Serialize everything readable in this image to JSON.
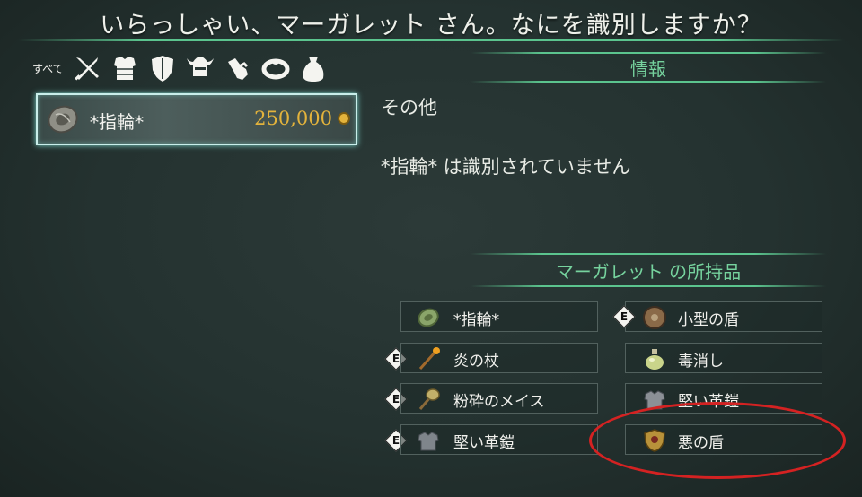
{
  "title": "いらっしゃい、マーガレット さん。なにを識別しますか？",
  "categories": {
    "all_label": "すべて",
    "icons": [
      "weapon-icon",
      "armor-icon",
      "shield-icon",
      "helmet-icon",
      "gauntlet-icon",
      "ring-icon",
      "pouch-icon"
    ]
  },
  "selected_item": {
    "name": "*指輪*",
    "price": "250,000",
    "icon": "ring-icon"
  },
  "info": {
    "header": "情報",
    "category": "その他",
    "description": "*指輪* は識別されていません"
  },
  "inventory": {
    "header": "マーガレット の所持品",
    "equip_mark": "E",
    "items": [
      {
        "name": "*指輪*",
        "equipped": false,
        "icon": "ring-icon"
      },
      {
        "name": "小型の盾",
        "equipped": true,
        "icon": "round-shield-icon"
      },
      {
        "name": "炎の杖",
        "equipped": true,
        "icon": "staff-icon"
      },
      {
        "name": "毒消し",
        "equipped": false,
        "icon": "potion-icon"
      },
      {
        "name": "粉砕のメイス",
        "equipped": true,
        "icon": "mace-icon"
      },
      {
        "name": "堅い革鎧",
        "equipped": false,
        "icon": "leather-armor-icon"
      },
      {
        "name": "堅い革鎧",
        "equipped": true,
        "icon": "leather-armor-icon"
      },
      {
        "name": "悪の盾",
        "equipped": false,
        "icon": "evil-shield-icon"
      }
    ]
  },
  "colors": {
    "accent": "#5bc48e",
    "gold": "#e3b33c",
    "highlight": "#d42222"
  }
}
